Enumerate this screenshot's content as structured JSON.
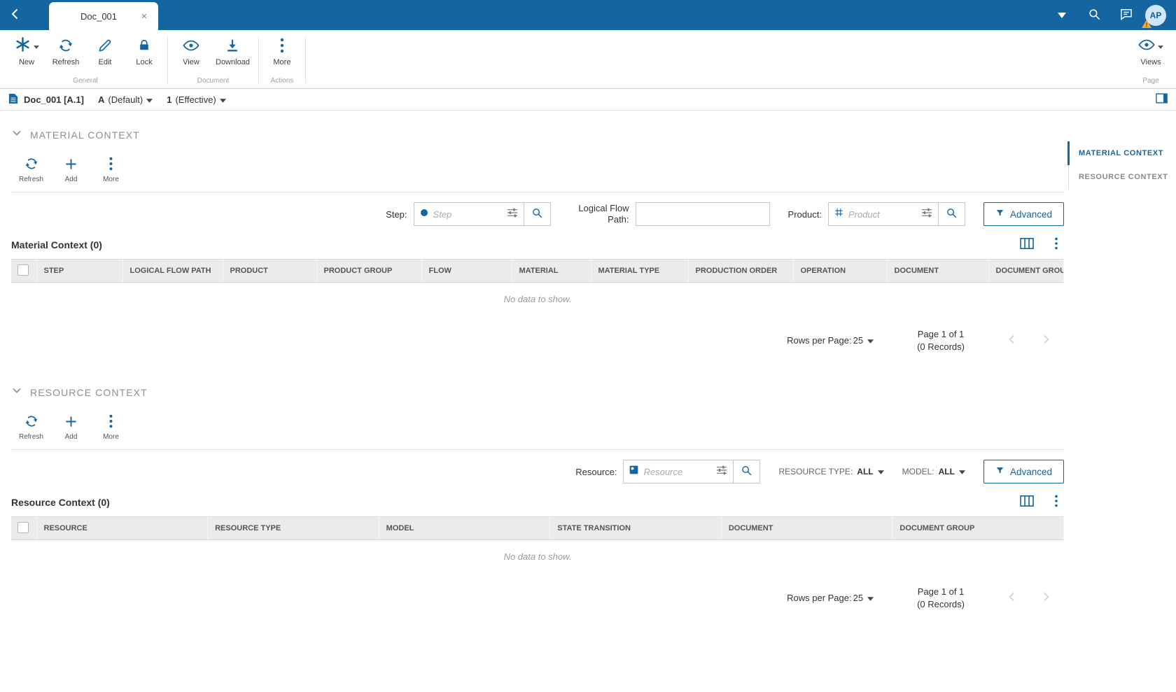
{
  "colors": {
    "topbar": "#1566a0",
    "accent": "#1565a0",
    "warning": "#f2a638",
    "table_header_bg": "#ebebeb"
  },
  "topbar": {
    "tab_title": "Doc_001",
    "close_label": "×",
    "avatar_initials": "AP",
    "avatar_badge": "!"
  },
  "ribbon": {
    "groups": [
      {
        "label": "General",
        "buttons": [
          {
            "label": "New"
          },
          {
            "label": "Refresh"
          },
          {
            "label": "Edit"
          },
          {
            "label": "Lock"
          }
        ]
      },
      {
        "label": "Document",
        "buttons": [
          {
            "label": "View"
          },
          {
            "label": "Download"
          }
        ]
      },
      {
        "label": "Actions",
        "buttons": [
          {
            "label": "More"
          }
        ]
      }
    ],
    "views_label": "Views",
    "views_group_label": "Page"
  },
  "breadcrumb": {
    "doc_id": "Doc_001 [A.1]",
    "revision_value": "A",
    "revision_label": "(Default)",
    "version_value": "1",
    "version_label": "(Effective)"
  },
  "page_nav": {
    "items": [
      {
        "label": "MATERIAL CONTEXT",
        "active": true
      },
      {
        "label": "RESOURCE CONTEXT",
        "active": false
      }
    ]
  },
  "material": {
    "title": "MATERIAL CONTEXT",
    "toolbar": {
      "refresh": "Refresh",
      "add": "Add",
      "more": "More"
    },
    "filters": {
      "step_label": "Step:",
      "step_placeholder": "Step",
      "lfp_label": "Logical Flow Path:",
      "product_label": "Product:",
      "product_placeholder": "Product",
      "advanced": "Advanced"
    },
    "table_title": "Material Context (0)",
    "columns": [
      "STEP",
      "LOGICAL FLOW PATH",
      "PRODUCT",
      "PRODUCT GROUP",
      "FLOW",
      "MATERIAL",
      "MATERIAL TYPE",
      "PRODUCTION ORDER",
      "OPERATION",
      "DOCUMENT",
      "DOCUMENT GROUP"
    ],
    "empty": "No data to show.",
    "pagination": {
      "rows_label": "Rows per Page:",
      "rows_value": "25",
      "page": "Page 1 of 1",
      "records": "(0 Records)"
    }
  },
  "resource": {
    "title": "RESOURCE CONTEXT",
    "toolbar": {
      "refresh": "Refresh",
      "add": "Add",
      "more": "More"
    },
    "filters": {
      "resource_label": "Resource:",
      "resource_placeholder": "Resource",
      "type_label": "RESOURCE TYPE:",
      "type_value": "ALL",
      "model_label": "MODEL:",
      "model_value": "ALL",
      "advanced": "Advanced"
    },
    "table_title": "Resource Context (0)",
    "columns": [
      "RESOURCE",
      "RESOURCE TYPE",
      "MODEL",
      "STATE TRANSITION",
      "DOCUMENT",
      "DOCUMENT GROUP"
    ],
    "empty": "No data to show.",
    "pagination": {
      "rows_label": "Rows per Page:",
      "rows_value": "25",
      "page": "Page 1 of 1",
      "records": "(0 Records)"
    }
  }
}
